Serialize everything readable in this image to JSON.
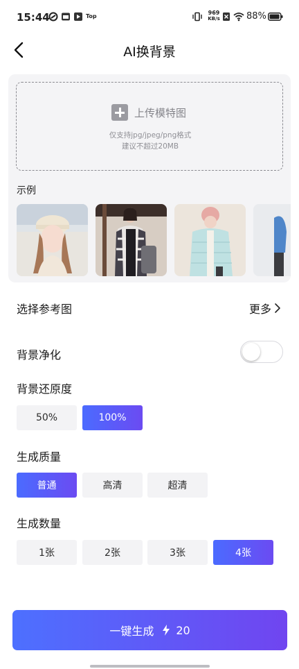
{
  "status_bar": {
    "time": "15:44",
    "speed_value": "969",
    "speed_unit": "KB/s",
    "app_label": "Top",
    "battery": "88%"
  },
  "header": {
    "title": "AI换背景"
  },
  "upload": {
    "label": "上传模特图",
    "hint_formats": "仅支持jpg/jpeg/png格式",
    "hint_size": "建议不超过20MB"
  },
  "examples": {
    "label": "示例"
  },
  "reference": {
    "label": "选择参考图",
    "more": "更多"
  },
  "purify": {
    "label": "背景净化",
    "enabled": false
  },
  "restore": {
    "label": "背景还原度",
    "options": [
      "50%",
      "100%"
    ],
    "selected": "100%"
  },
  "quality": {
    "label": "生成质量",
    "options": [
      "普通",
      "高清",
      "超清"
    ],
    "selected": "普通"
  },
  "count": {
    "label": "生成数量",
    "options": [
      "1张",
      "2张",
      "3张",
      "4张"
    ],
    "selected": "4张"
  },
  "cta": {
    "label": "一键生成",
    "cost": "20"
  },
  "colors": {
    "accent_start": "#4b6bff",
    "accent_end": "#6b4bf2"
  }
}
